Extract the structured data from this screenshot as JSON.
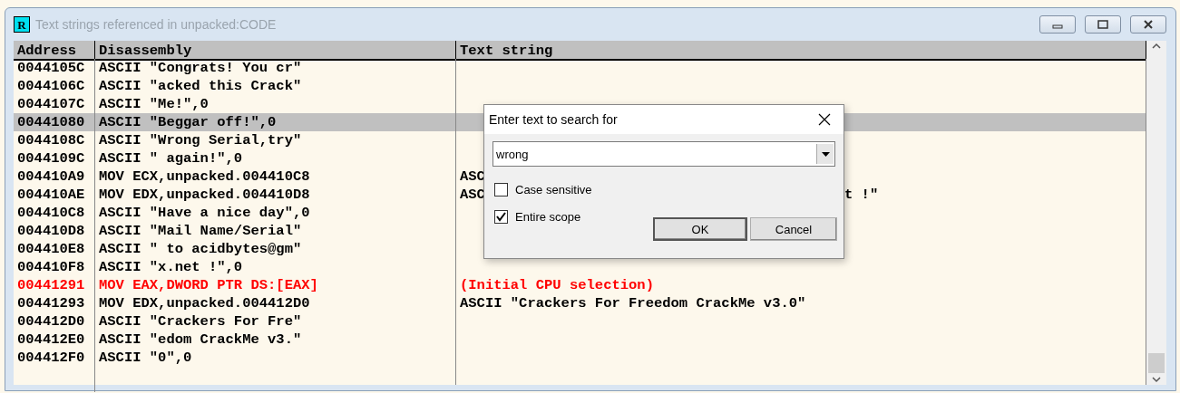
{
  "window": {
    "title": "Text strings referenced in unpacked:CODE",
    "icon_letter": "R",
    "active": false
  },
  "table": {
    "columns": [
      "Address",
      "Disassembly",
      "Text string"
    ],
    "rows": [
      {
        "address": "0044105C",
        "disassembly": "ASCII \"Congrats! You cr\"",
        "selected": false,
        "initial": false
      },
      {
        "address": "0044106C",
        "disassembly": "ASCII \"acked this Crack\"",
        "selected": false,
        "initial": false
      },
      {
        "address": "0044107C",
        "disassembly": "ASCII \"Me!\",0",
        "selected": false,
        "initial": false
      },
      {
        "address": "00441080",
        "disassembly": "ASCII \"Beggar off!\",0",
        "selected": true,
        "initial": false
      },
      {
        "address": "0044108C",
        "disassembly": "ASCII \"Wrong Serial,try\"",
        "selected": false,
        "initial": false
      },
      {
        "address": "0044109C",
        "disassembly": "ASCII \" again!\",0",
        "selected": false,
        "initial": false
      },
      {
        "address": "004410A9",
        "disassembly": "MOV ECX,unpacked.004410C8",
        "text": "ASC",
        "selected": false,
        "initial": false
      },
      {
        "address": "004410AE",
        "disassembly": "MOV EDX,unpacked.004410D8",
        "text": "ASC",
        "text_tail": "t !\"",
        "selected": false,
        "initial": false
      },
      {
        "address": "004410C8",
        "disassembly": "ASCII \"Have a nice day\",0",
        "selected": false,
        "initial": false
      },
      {
        "address": "004410D8",
        "disassembly": "ASCII \"Mail Name/Serial\"",
        "selected": false,
        "initial": false
      },
      {
        "address": "004410E8",
        "disassembly": "ASCII \" to acidbytes@gm\"",
        "selected": false,
        "initial": false
      },
      {
        "address": "004410F8",
        "disassembly": "ASCII \"x.net !\",0",
        "selected": false,
        "initial": false
      },
      {
        "address": "00441291",
        "disassembly": "MOV EAX,DWORD PTR DS:[EAX]",
        "text": "(Initial CPU selection)",
        "selected": false,
        "initial": true
      },
      {
        "address": "00441293",
        "disassembly": "MOV EDX,unpacked.004412D0",
        "text": "ASCII \"Crackers For Freedom CrackMe v3.0\"",
        "selected": false,
        "initial": false
      },
      {
        "address": "004412D0",
        "disassembly": "ASCII \"Crackers For Fre\"",
        "selected": false,
        "initial": false
      },
      {
        "address": "004412E0",
        "disassembly": "ASCII \"edom CrackMe v3.\"",
        "selected": false,
        "initial": false
      },
      {
        "address": "004412F0",
        "disassembly": "ASCII \"0\",0",
        "selected": false,
        "initial": false
      }
    ]
  },
  "dialog": {
    "title": "Enter text to search for",
    "search": {
      "value": "wrong"
    },
    "options": [
      {
        "label": "Case sensitive",
        "checked": false
      },
      {
        "label": "Entire scope",
        "checked": true
      }
    ],
    "buttons": [
      {
        "label": "OK",
        "default": true
      },
      {
        "label": "Cancel",
        "default": false
      }
    ]
  }
}
